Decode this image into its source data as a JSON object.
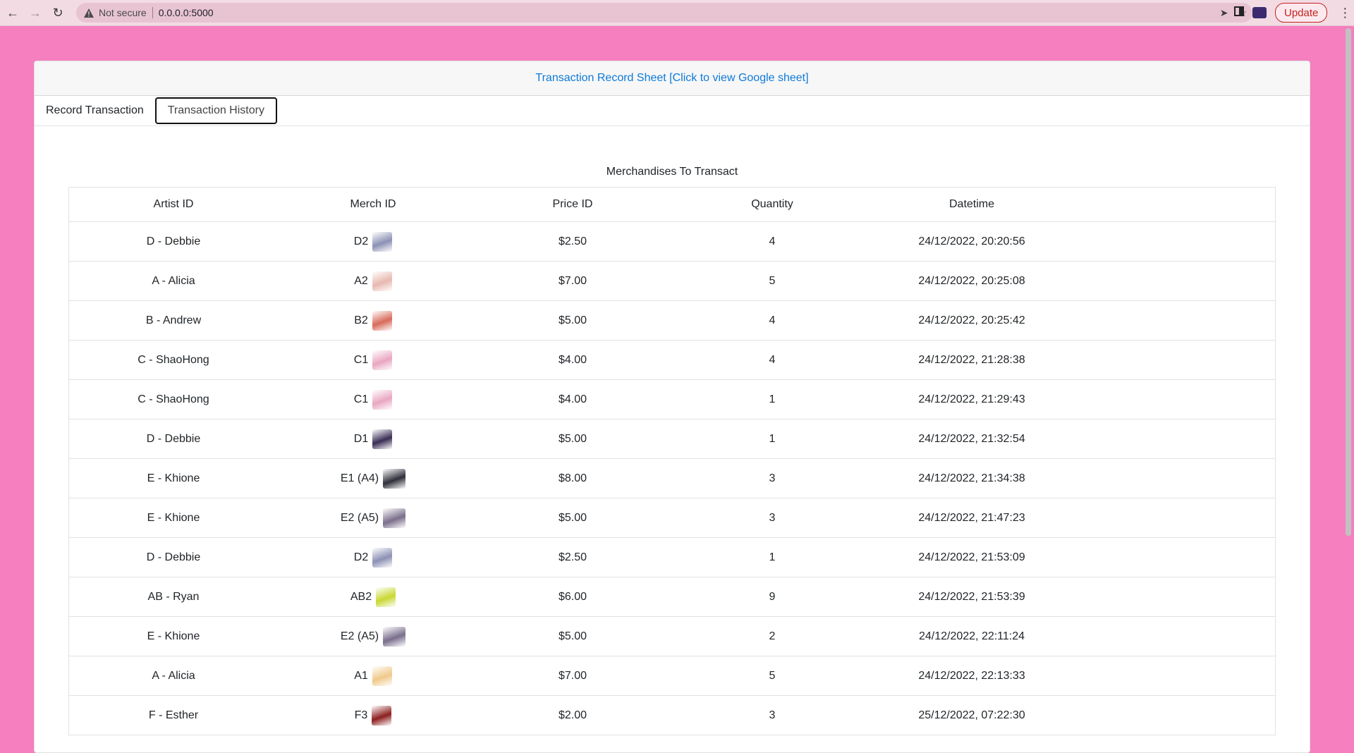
{
  "browser": {
    "security_label": "Not secure",
    "url": "0.0.0.0:5000",
    "update_label": "Update"
  },
  "page": {
    "header_link": "Transaction Record Sheet [Click to view Google sheet]",
    "tabs": [
      "Record Transaction",
      "Transaction History"
    ],
    "section_title": "Merchandises To Transact",
    "columns": [
      "Artist ID",
      "Merch ID",
      "Price ID",
      "Quantity",
      "Datetime"
    ]
  },
  "rows": [
    {
      "artist": "D - Debbie",
      "merch": "D2",
      "price": "$2.50",
      "qty": "4",
      "datetime": "24/12/2022, 20:20:56",
      "thumb_color": "#8c90b5"
    },
    {
      "artist": "A - Alicia",
      "merch": "A2",
      "price": "$7.00",
      "qty": "5",
      "datetime": "24/12/2022, 20:25:08",
      "thumb_color": "#e8b8b0"
    },
    {
      "artist": "B - Andrew",
      "merch": "B2",
      "price": "$5.00",
      "qty": "4",
      "datetime": "24/12/2022, 20:25:42",
      "thumb_color": "#d86a5a"
    },
    {
      "artist": "C - ShaoHong",
      "merch": "C1",
      "price": "$4.00",
      "qty": "4",
      "datetime": "24/12/2022, 21:28:38",
      "thumb_color": "#e9a6c0"
    },
    {
      "artist": "C - ShaoHong",
      "merch": "C1",
      "price": "$4.00",
      "qty": "1",
      "datetime": "24/12/2022, 21:29:43",
      "thumb_color": "#e9a6c0"
    },
    {
      "artist": "D - Debbie",
      "merch": "D1",
      "price": "$5.00",
      "qty": "1",
      "datetime": "24/12/2022, 21:32:54",
      "thumb_color": "#3a2d55"
    },
    {
      "artist": "E - Khione",
      "merch": "E1 (A4)",
      "price": "$8.00",
      "qty": "3",
      "datetime": "24/12/2022, 21:34:38",
      "thumb_color": "#2f2f3a"
    },
    {
      "artist": "E - Khione",
      "merch": "E2 (A5)",
      "price": "$5.00",
      "qty": "3",
      "datetime": "24/12/2022, 21:47:23",
      "thumb_color": "#7a6e8c"
    },
    {
      "artist": "D - Debbie",
      "merch": "D2",
      "price": "$2.50",
      "qty": "1",
      "datetime": "24/12/2022, 21:53:09",
      "thumb_color": "#8c90b5"
    },
    {
      "artist": "AB - Ryan",
      "merch": "AB2",
      "price": "$6.00",
      "qty": "9",
      "datetime": "24/12/2022, 21:53:39",
      "thumb_color": "#c9d832"
    },
    {
      "artist": "E - Khione",
      "merch": "E2 (A5)",
      "price": "$5.00",
      "qty": "2",
      "datetime": "24/12/2022, 22:11:24",
      "thumb_color": "#7a6e8c"
    },
    {
      "artist": "A - Alicia",
      "merch": "A1",
      "price": "$7.00",
      "qty": "5",
      "datetime": "24/12/2022, 22:13:33",
      "thumb_color": "#f0c98a"
    },
    {
      "artist": "F - Esther",
      "merch": "F3",
      "price": "$2.00",
      "qty": "3",
      "datetime": "25/12/2022, 07:22:30",
      "thumb_color": "#8c1e1e"
    }
  ],
  "colors": {
    "page_bg": "#f57fbf",
    "link": "#0d7ad9"
  }
}
